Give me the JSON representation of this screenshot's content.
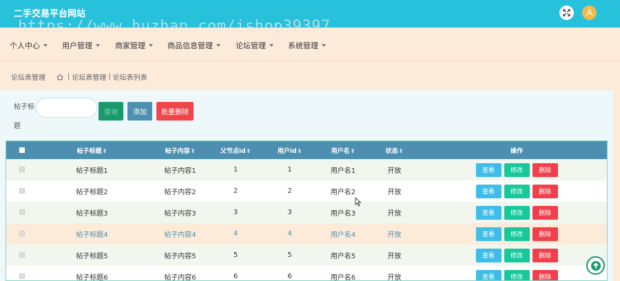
{
  "header": {
    "site_title": "二手交易平台网站",
    "watermark": "https://www.huzhan.com/ishop39397"
  },
  "nav": {
    "items": [
      {
        "label": "个人中心"
      },
      {
        "label": "用户管理"
      },
      {
        "label": "商家管理"
      },
      {
        "label": "商品信息管理"
      },
      {
        "label": "论坛管理"
      },
      {
        "label": "系统管理"
      }
    ]
  },
  "breadcrumb": {
    "left": "论坛表管理",
    "sep1": "|",
    "crumb1": "论坛表管理",
    "sep2": "|",
    "crumb2": "论坛表列表"
  },
  "search": {
    "label": "帖子标题",
    "value": "",
    "search_label": "查询",
    "add_label": "添加",
    "batch_delete_label": "批量删除"
  },
  "table": {
    "columns": [
      "帖子标题",
      "帖子内容",
      "父节点id",
      "用户id",
      "用户名",
      "状态",
      "操作"
    ],
    "sort_glyph": "⇕",
    "actions": {
      "view": "查看",
      "edit": "修改",
      "delete": "删除"
    },
    "rows": [
      {
        "title": "帖子标题1",
        "content": "帖子内容1",
        "parentid": "1",
        "userid": "1",
        "username": "用户名1",
        "status": "开放"
      },
      {
        "title": "帖子标题2",
        "content": "帖子内容2",
        "parentid": "2",
        "userid": "2",
        "username": "用户名2",
        "status": "开放"
      },
      {
        "title": "帖子标题3",
        "content": "帖子内容3",
        "parentid": "3",
        "userid": "3",
        "username": "用户名3",
        "status": "开放"
      },
      {
        "title": "帖子标题4",
        "content": "帖子内容4",
        "parentid": "4",
        "userid": "4",
        "username": "用户名4",
        "status": "开放"
      },
      {
        "title": "帖子标题5",
        "content": "帖子内容5",
        "parentid": "5",
        "userid": "5",
        "username": "用户名5",
        "status": "开放"
      },
      {
        "title": "帖子标题6",
        "content": "帖子内容6",
        "parentid": "6",
        "userid": "6",
        "username": "用户名6",
        "status": "开放"
      }
    ]
  },
  "colors": {
    "topbar": "#27c1dc",
    "nav_bg": "#fcebd9",
    "header_row": "#4d8fb0",
    "view": "#3dbde8",
    "edit": "#17c89a",
    "delete": "#f23f4b"
  },
  "icons": {
    "fullscreen": "expand-icon",
    "avatar": "user-icon",
    "home": "home-icon",
    "back_to_top": "arrow-up-icon"
  }
}
